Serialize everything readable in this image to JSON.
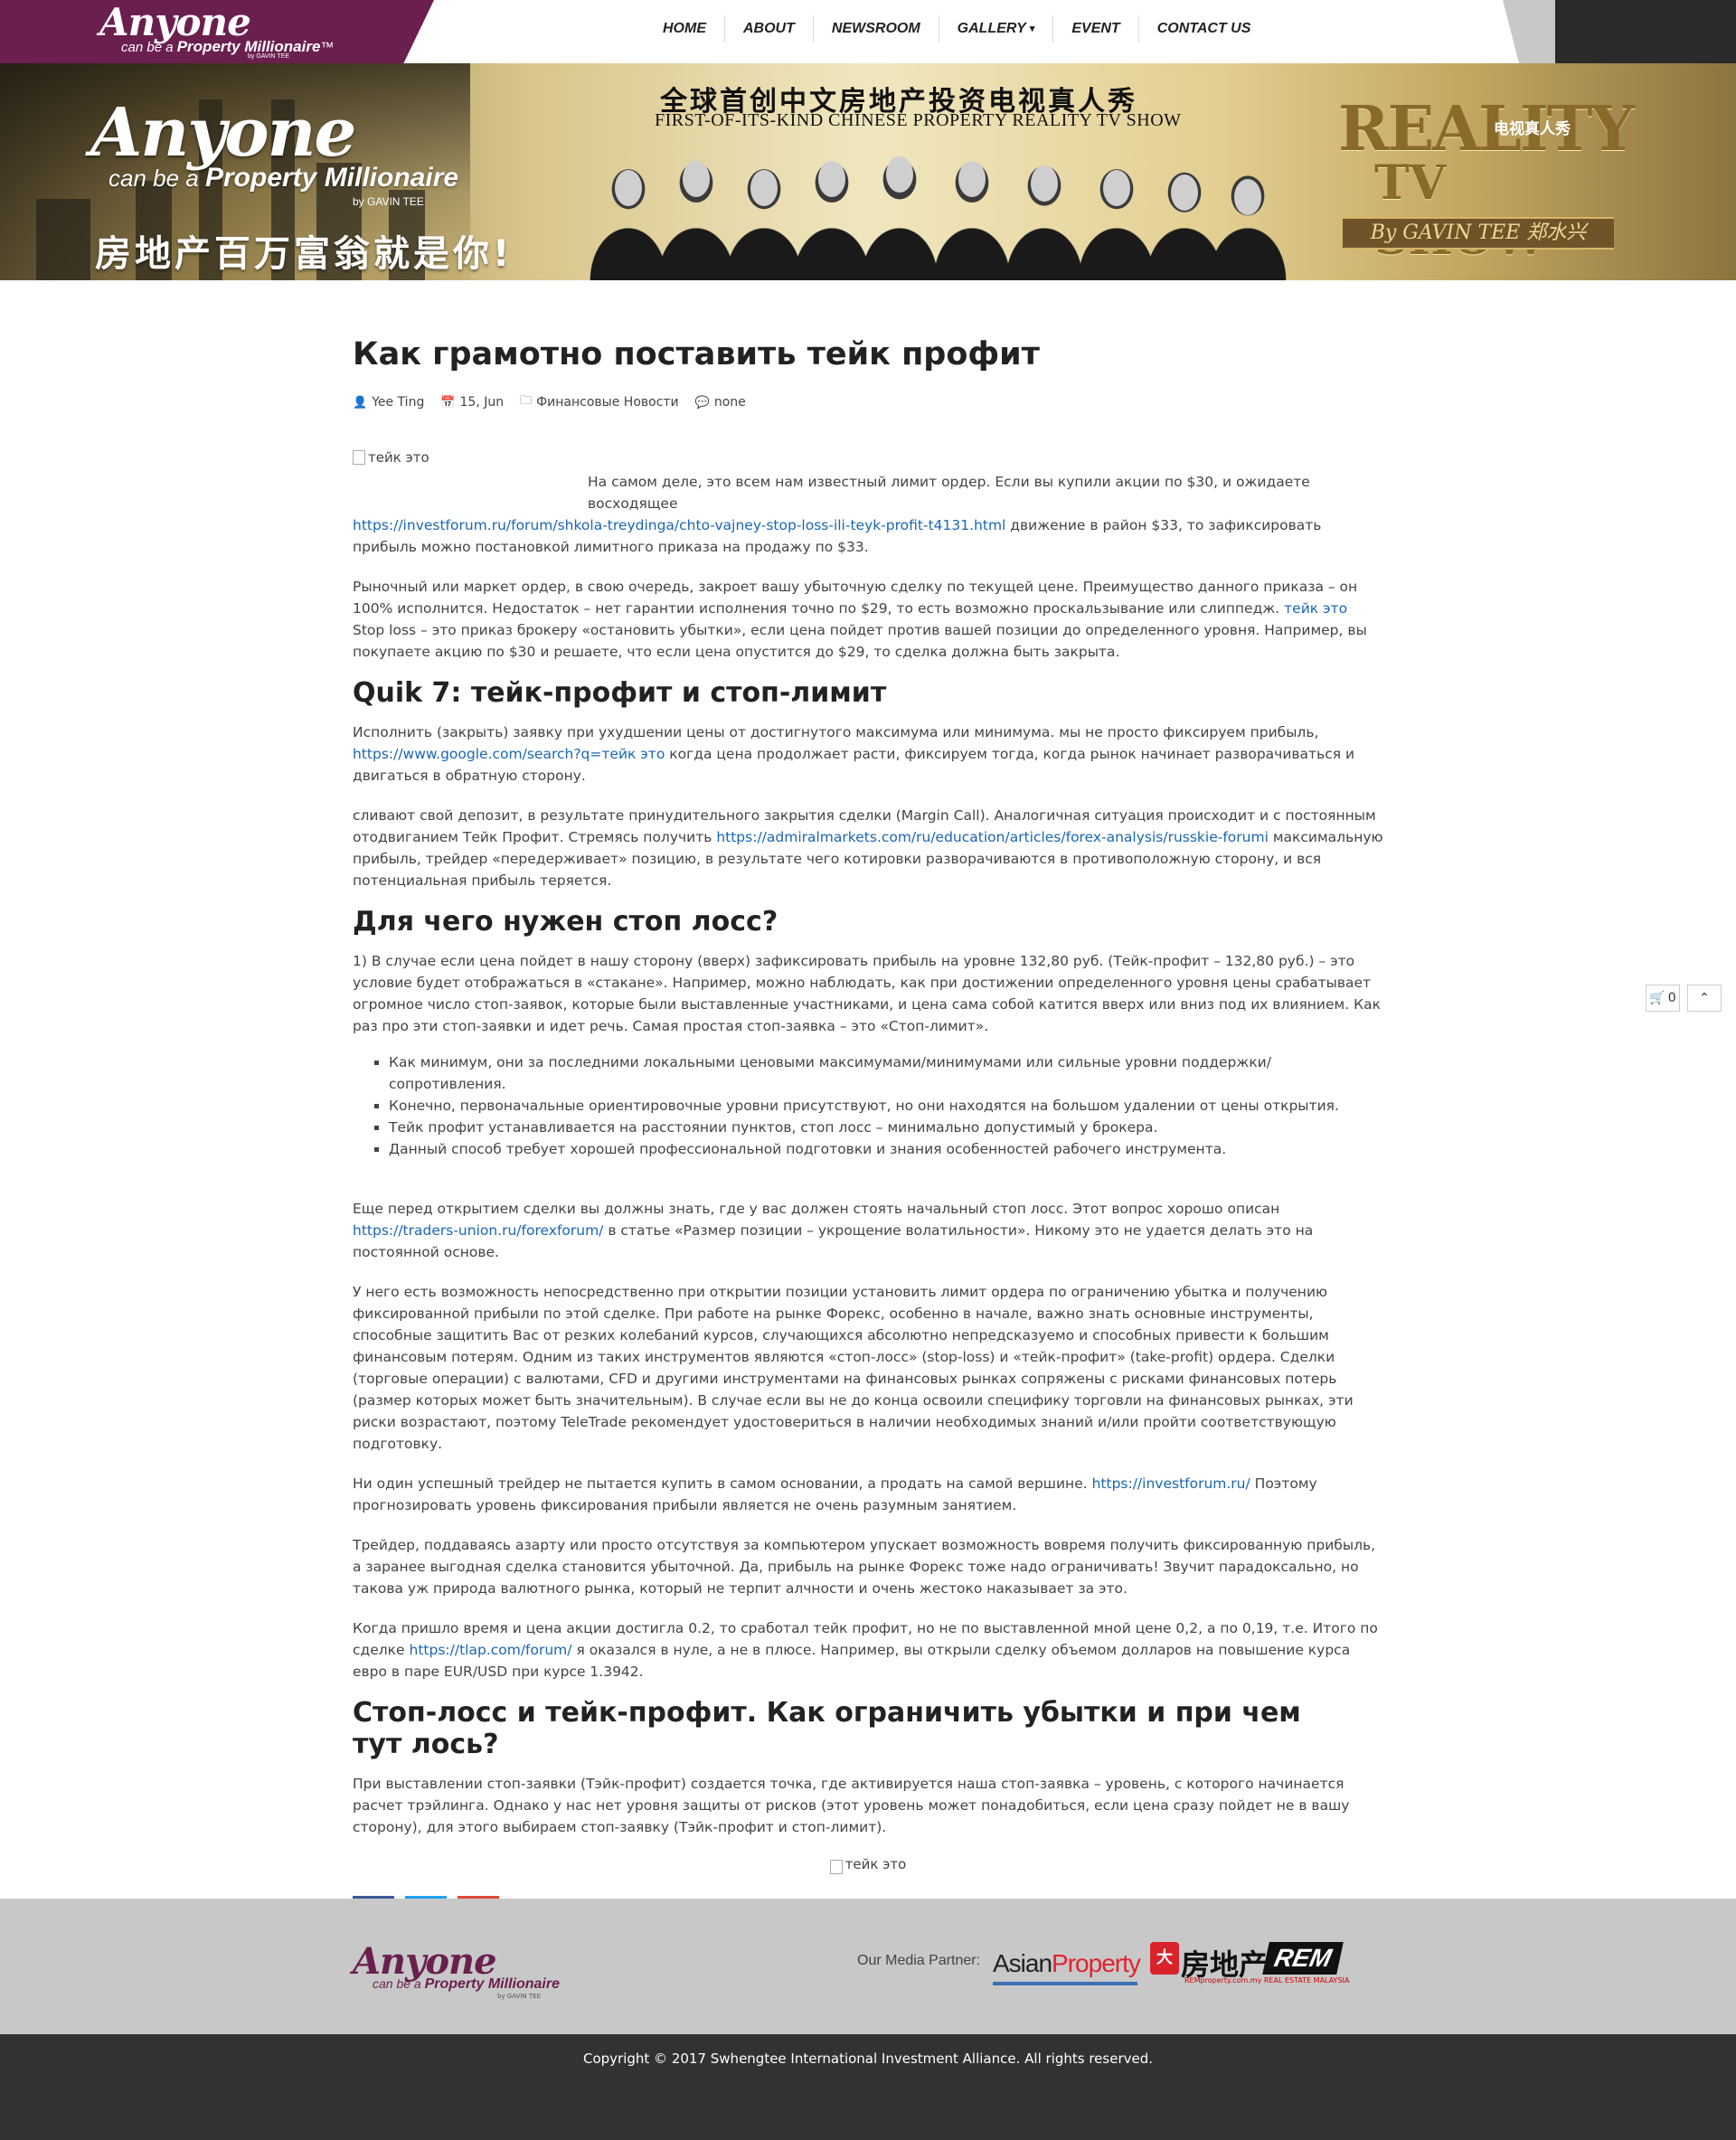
{
  "nav": {
    "logo": {
      "main": "Anyone",
      "sub_prefix": "can be a ",
      "sub_bold": "Property Millionaire",
      "tm": "™",
      "by": "by GAVIN TEE"
    },
    "items": [
      {
        "label": "HOME"
      },
      {
        "label": "ABOUT"
      },
      {
        "label": "NEWSROOM"
      },
      {
        "label": "GALLERY"
      },
      {
        "label": "EVENT"
      },
      {
        "label": "CONTACT US"
      }
    ]
  },
  "banner": {
    "logo_main": "Anyone",
    "logo_sub_prefix": "can be a ",
    "logo_sub_bold": "Property Millionaire",
    "logo_by": "by GAVIN TEE",
    "cn_tagline": "房地产百万富翁就是你!",
    "cn_title": "全球首创中文房地产投资电视真人秀",
    "en_title": "FIRST-OF-ITS-KIND CHINESE PROPERTY REALITY TV SHOW",
    "rtv_line1": "REALITY",
    "rtv_line2": "TV SHOW",
    "rtv_cn": "电视真人秀",
    "rtv_by": "By GAVIN TEE 郑水兴"
  },
  "article": {
    "title": "Как грамотно поставить тейк профит",
    "meta": {
      "author": "Yee Ting",
      "date": "15, Jun",
      "category": "Финансовые Новости",
      "comments": "none"
    },
    "img_alt": "тейк это",
    "p1_text": "На самом деле, это всем нам известный лимит ордер. Если вы купили акции по $30, и ожидаете восходящее",
    "p1_link": "https://investforum.ru/forum/shkola-treydinga/chto-vajney-stop-loss-ili-teyk-profit-t4131.html",
    "p1_after": " движение в район $33, то зафиксировать прибыль можно постановкой лимитного приказа на продажу по $33.",
    "p2_before": "Рыночный или маркет ордер, в свою очередь, закроет вашу убыточную сделку по текущей цене. Преимущество данного приказа – он 100% исполнится. Недостаток – нет гарантии исполнения точно по $29, то есть возможно проскальзывание или слиппедж. ",
    "p2_link": "тейк это",
    "p2_after": " Stop loss – это приказ брокеру «остановить убытки», если цена пойдет против вашей позиции до определенного уровня. Например, вы покупаете акцию по $30 и решаете, что если цена опустится до $29, то сделка должна быть закрыта.",
    "h2_1": "Quik 7: тейк-профит и стоп-лимит",
    "p3_before": "Исполнить (закрыть) заявку при ухудшении цены от достигнутого максимума или минимума. мы не просто фиксируем прибыль, ",
    "p3_link": "https://www.google.com/search?q=тейк это",
    "p3_after": " когда цена продолжает расти, фиксируем тогда, когда рынок начинает разворачиваться и двигаться в обратную сторону.",
    "p4_before": "сливают свой депозит, в результате принудительного закрытия сделки (Margin Call). Аналогичная ситуация происходит и с постоянным отодвиганием Тейк Профит. Стремясь получить ",
    "p4_link": "https://admiralmarkets.com/ru/education/articles/forex-analysis/russkie-forumi",
    "p4_after": " максимальную прибыль, трейдер «передерживает» позицию, в результате чего котировки разворачиваются в противоположную сторону, и вся потенциальная прибыль теряется.",
    "h2_2": "Для чего нужен стоп лосс?",
    "p5": "1) В случае если цена пойдет в нашу сторону (вверх) зафиксировать прибыль на уровне 132,80 руб. (Тейк-профит – 132,80 руб.) – это условие будет отображаться в «стакане». Например, можно наблюдать, как при достижении определенного уровня цены срабатывает огромное число стоп-заявок, которые были выставленные участниками, и цена сама собой катится вверх или вниз под их влиянием. Как раз про эти стоп-заявки и идет речь. Самая простая стоп-заявка – это «Стоп-лимит».",
    "list": [
      "Как минимум, они за последними локальными ценовыми максимумами/минимумами или сильные уровни поддержки/сопротивления.",
      "Конечно, первоначальные ориентировочные уровни присутствуют, но они находятся на большом удалении от цены открытия.",
      "Тейк профит устанавливается на расстоянии пунктов, стоп лосс – минимально допустимый у брокера.",
      "Данный способ требует хорошей профессиональной подготовки и знания особенностей рабочего инструмента."
    ],
    "p6_before": "Еще перед открытием сделки вы должны знать, где у вас должен стоять начальный стоп лосс. Этот вопрос хорошо описан ",
    "p6_link": "https://traders-union.ru/forexforum/",
    "p6_after": " в статье «Размер позиции – укрощение волатильности». Никому это не удается делать это на постоянной основе.",
    "p7": "У него есть возможность непосредственно при открытии позиции установить лимит ордера по ограничению убытка и получению фиксированной прибыли по этой сделке. При работе на рынке Форекс, особенно в начале, важно знать основные инструменты, способные защитить Вас от резких колебаний курсов, случающихся абсолютно непредсказуемо и способных привести к большим финансовым потерям. Одним из таких инструментов являются «стоп-лосс» (stop-loss) и «тейк-профит» (take-profit) ордера. Сделки (торговые операции) с валютами, CFD и другими инструментами на финансовых рынках сопряжены с рисками финансовых потерь (размер которых может быть значительным). В случае если вы не до конца освоили специфику торговли на финансовых рынках, эти риски возрастают, поэтому TeleTrade рекомендует удостовериться в наличии необходимых знаний и/или пройти соответствующую подготовку.",
    "p8_before": "Ни один успешный трейдер не пытается купить в самом основании, а продать на самой вершине. ",
    "p8_link": "https://investforum.ru/",
    "p8_after": " Поэтому прогнозировать уровень фиксирования прибыли является не очень разумным занятием.",
    "p9": "Трейдер, поддаваясь азарту или просто отсутствуя за компьютером упускает возможность вовремя получить фиксированную прибыль, а заранее выгодная сделка становится убыточной. Да, прибыль на рынке Форекс тоже надо ограничивать! Звучит парадоксально, но такова уж природа валютного рынка, который не терпит алчности и очень жестоко наказывает за это.",
    "p10_before": "Когда пришло время и цена акции достигла 0.2, то сработал тейк профит, но не по выставленной мной цене 0,2, а по 0,19, т.е. Итого по сделке ",
    "p10_link": "https://tlap.com/forum/",
    "p10_after": " я оказался в нуле, а не в плюсе. Например, вы открыли сделку объемом долларов на повышение курса евро в паре EUR/USD при курсе 1.3942.",
    "h2_3": "Стоп-лосс и тейк-профит. Как ограничить убытки и при чем тут лось?",
    "p11": "При выставлении стоп-заявки (Тэйк-профит) создается точка, где активируется наша стоп-заявка – уровень, с которого начинается расчет трэйлинга. Однако у нас нет уровня защиты от рисков (этот уровень может понадобиться, если цена сразу пойдет не в вашу сторону), для этого выбираем стоп-заявку (Тэйк-профит и стоп-лимит).",
    "img2_alt": "тейк это",
    "social": {
      "fb": "f",
      "tw": "t",
      "gp": "g+"
    }
  },
  "widgets": {
    "cart_count": "0"
  },
  "footer": {
    "logo_main": "Anyone",
    "logo_sub_prefix": "can be a ",
    "logo_sub_bold": "Property Millionaire",
    "logo_by": "by GAVIN TEE",
    "partner_label": "Our Media Partner:",
    "asian": "Asian",
    "property": "Property",
    "rem_cn_box": "大",
    "rem_cn": "房地产",
    "rem": "REM",
    "rem_sub": "REMproperty.com.my REAL ESTATE MALAYSIA",
    "copyright": "Copyright © 2017 Swhengtee International Investment Alliance. All rights reserved."
  }
}
